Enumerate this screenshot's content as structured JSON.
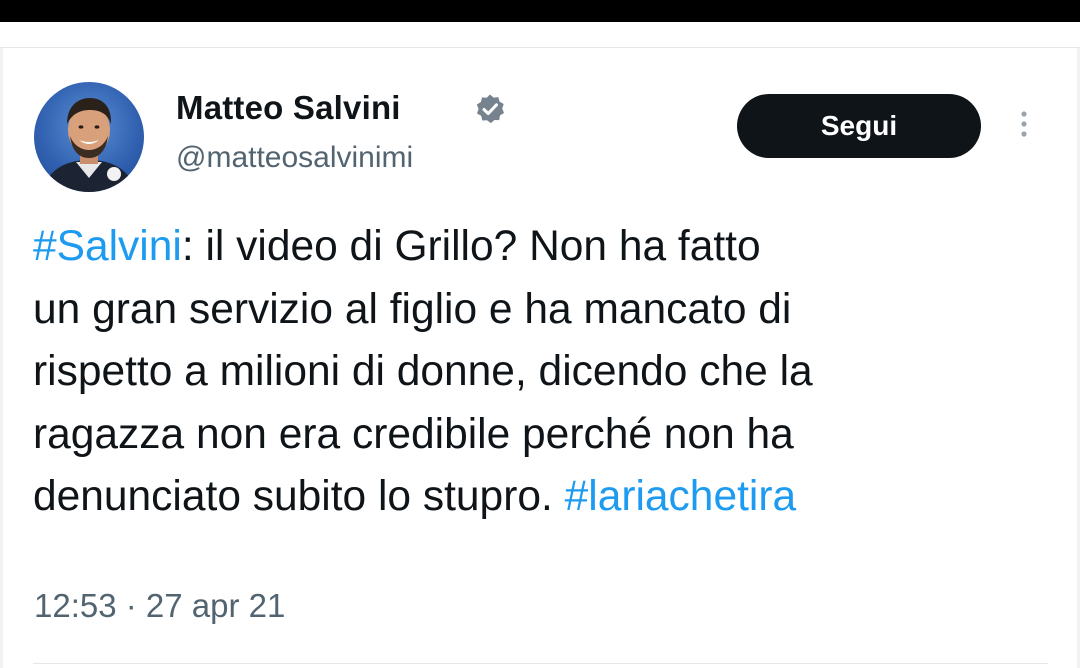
{
  "author": {
    "display_name": "Matteo Salvini",
    "handle": "@matteosalvinimi",
    "verified": true,
    "avatar_icon": "profile-photo-icon"
  },
  "follow_button": {
    "label": "Segui"
  },
  "more_menu": {
    "icon": "more-vertical-icon"
  },
  "tweet": {
    "lines": [
      {
        "hashtag": "#Salvini",
        "text": ": il video di Grillo? Non ha fatto"
      },
      {
        "text": "un gran servizio al figlio e ha mancato di"
      },
      {
        "text": "rispetto a milioni di donne, dicendo che la"
      },
      {
        "text": "ragazza non era credibile perché non ha"
      },
      {
        "text": "denunciato subito lo stupro. ",
        "hashtag_end": "#lariachetira"
      }
    ],
    "timestamp": "12:53 · 27 apr 21"
  },
  "colors": {
    "hashtag": "#1d9bf0",
    "secondary_text": "#536471",
    "primary_text": "#0f1419",
    "button_bg": "#0f1419",
    "verified_badge": "#1d9bf0"
  }
}
